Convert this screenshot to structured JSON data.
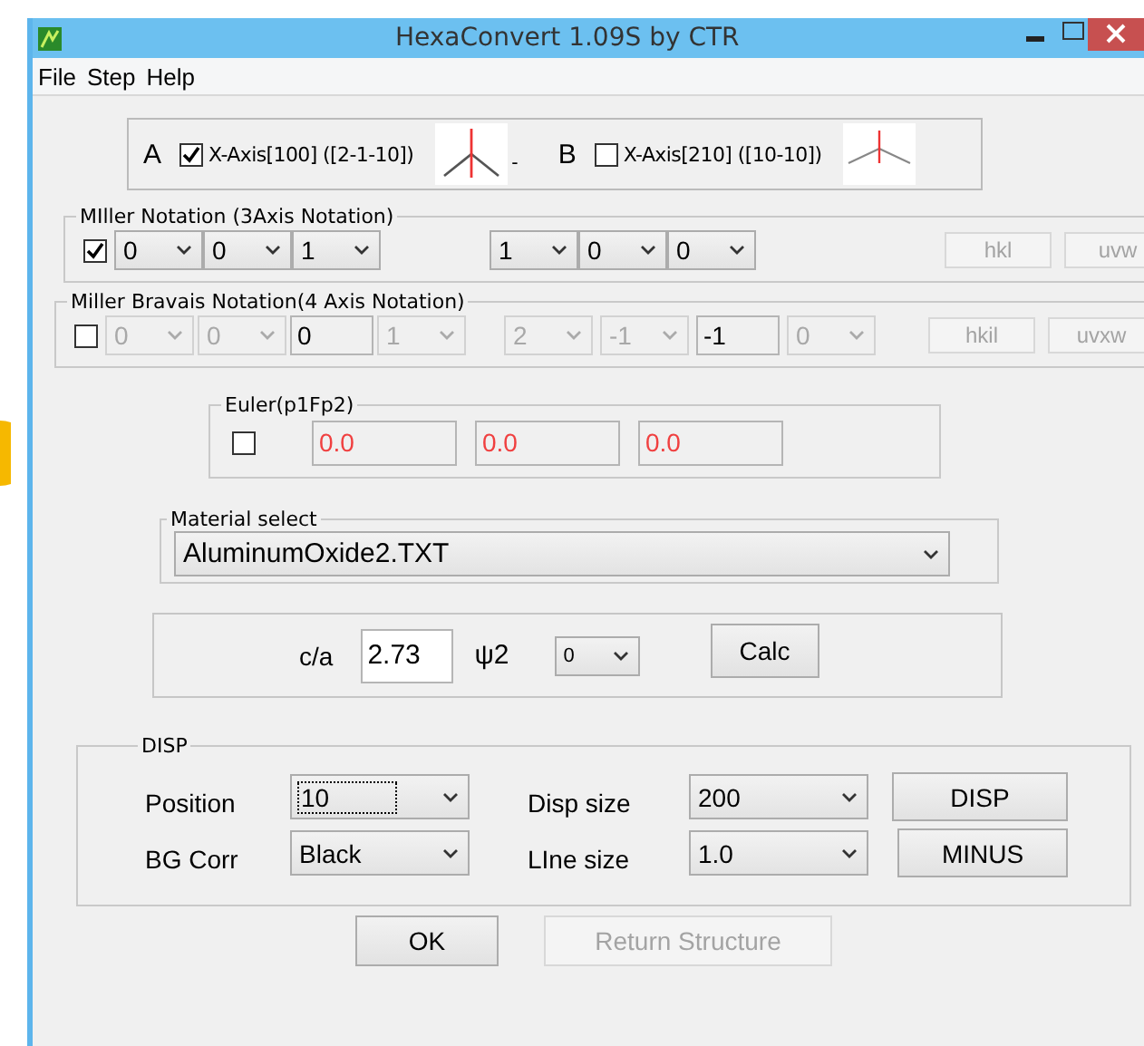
{
  "window": {
    "title": "HexaConvert 1.09S by CTR"
  },
  "menu": [
    "File",
    "Step",
    "Help"
  ],
  "axis_options": [
    {
      "letter": "A",
      "label": "X-Axis[100] ([2-1-10])",
      "checked": true,
      "kind": "steep"
    },
    {
      "letter": "B",
      "label": "X-Axis[210] ([10-10])",
      "checked": false,
      "kind": "flat"
    }
  ],
  "axis_separator": "-",
  "notations": [
    {
      "legend": "MIller Notation (3Axis Notation)",
      "checked": true,
      "left_fields": [
        {
          "kind": "select",
          "value": "0",
          "disabled": false
        },
        {
          "kind": "select",
          "value": "0",
          "disabled": false
        },
        {
          "kind": "select",
          "value": "1",
          "disabled": false
        }
      ],
      "right_fields": [
        {
          "kind": "select",
          "value": "1",
          "disabled": false
        },
        {
          "kind": "select",
          "value": "0",
          "disabled": false
        },
        {
          "kind": "select",
          "value": "0",
          "disabled": false
        }
      ],
      "buttons": [
        {
          "label": "hkl",
          "disabled": true
        },
        {
          "label": "uvw",
          "disabled": true
        }
      ]
    },
    {
      "legend": "Miller Bravais Notation(4 Axis Notation)",
      "checked": false,
      "left_fields": [
        {
          "kind": "select",
          "value": "0",
          "disabled": true
        },
        {
          "kind": "select",
          "value": "0",
          "disabled": true
        },
        {
          "kind": "input",
          "value": "0",
          "disabled": false
        },
        {
          "kind": "select",
          "value": "1",
          "disabled": true
        }
      ],
      "right_fields": [
        {
          "kind": "select",
          "value": "2",
          "disabled": true
        },
        {
          "kind": "select",
          "value": "-1",
          "disabled": true
        },
        {
          "kind": "input",
          "value": "-1",
          "disabled": false
        },
        {
          "kind": "select",
          "value": "0",
          "disabled": true
        }
      ],
      "buttons": [
        {
          "label": "hkil",
          "disabled": true
        },
        {
          "label": "uvxw",
          "disabled": true
        }
      ]
    }
  ],
  "euler": {
    "legend": "Euler(p1Fp2)",
    "checked": false,
    "values": [
      "0.0",
      "0.0",
      "0.0"
    ]
  },
  "material": {
    "legend": "Material select",
    "value": "AluminumOxide2.TXT"
  },
  "ratio": {
    "label": "c/a",
    "value": "2.73",
    "psi_label": "ψ2",
    "psi_value": "0",
    "button": "Calc"
  },
  "disp": {
    "legend": "DISP",
    "rows": [
      {
        "label": "Position",
        "value": "10",
        "focused": true,
        "label2": "Disp size",
        "value2": "200",
        "button": "DISP"
      },
      {
        "label": "BG Corr",
        "value": "Black",
        "focused": false,
        "label2": "LIne size",
        "value2": "1.0",
        "button": "MINUS"
      }
    ]
  },
  "footer_buttons": [
    {
      "label": "OK",
      "disabled": false
    },
    {
      "label": "Return Structure",
      "disabled": true
    }
  ]
}
